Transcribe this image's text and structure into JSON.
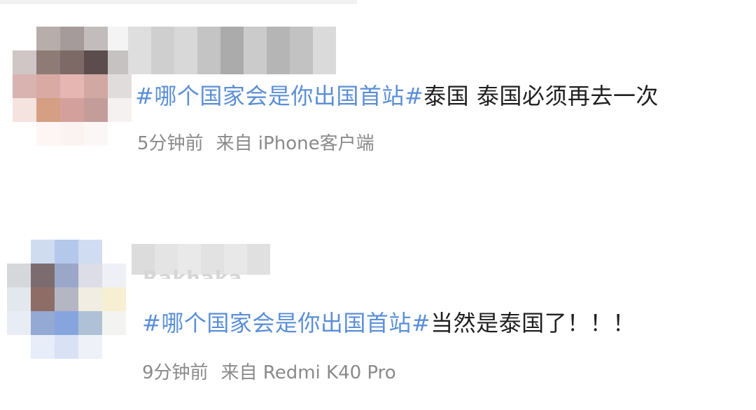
{
  "comments": [
    {
      "hashtag": "#哪个国家会是你出国首站#",
      "body": "泰国 泰国必须再去一次",
      "time": "5分钟前",
      "source": "来自 iPhone客户端"
    },
    {
      "username_partial": "Rakhaka",
      "hashtag": "#哪个国家会是你出国首站#",
      "body": "当然是泰国了！！！",
      "time": "9分钟前",
      "source": "来自 Redmi K40 Pro"
    }
  ],
  "colors": {
    "hashtag": "#5b8fd6",
    "text": "#1f1f1f",
    "meta": "#8a8a8a"
  }
}
